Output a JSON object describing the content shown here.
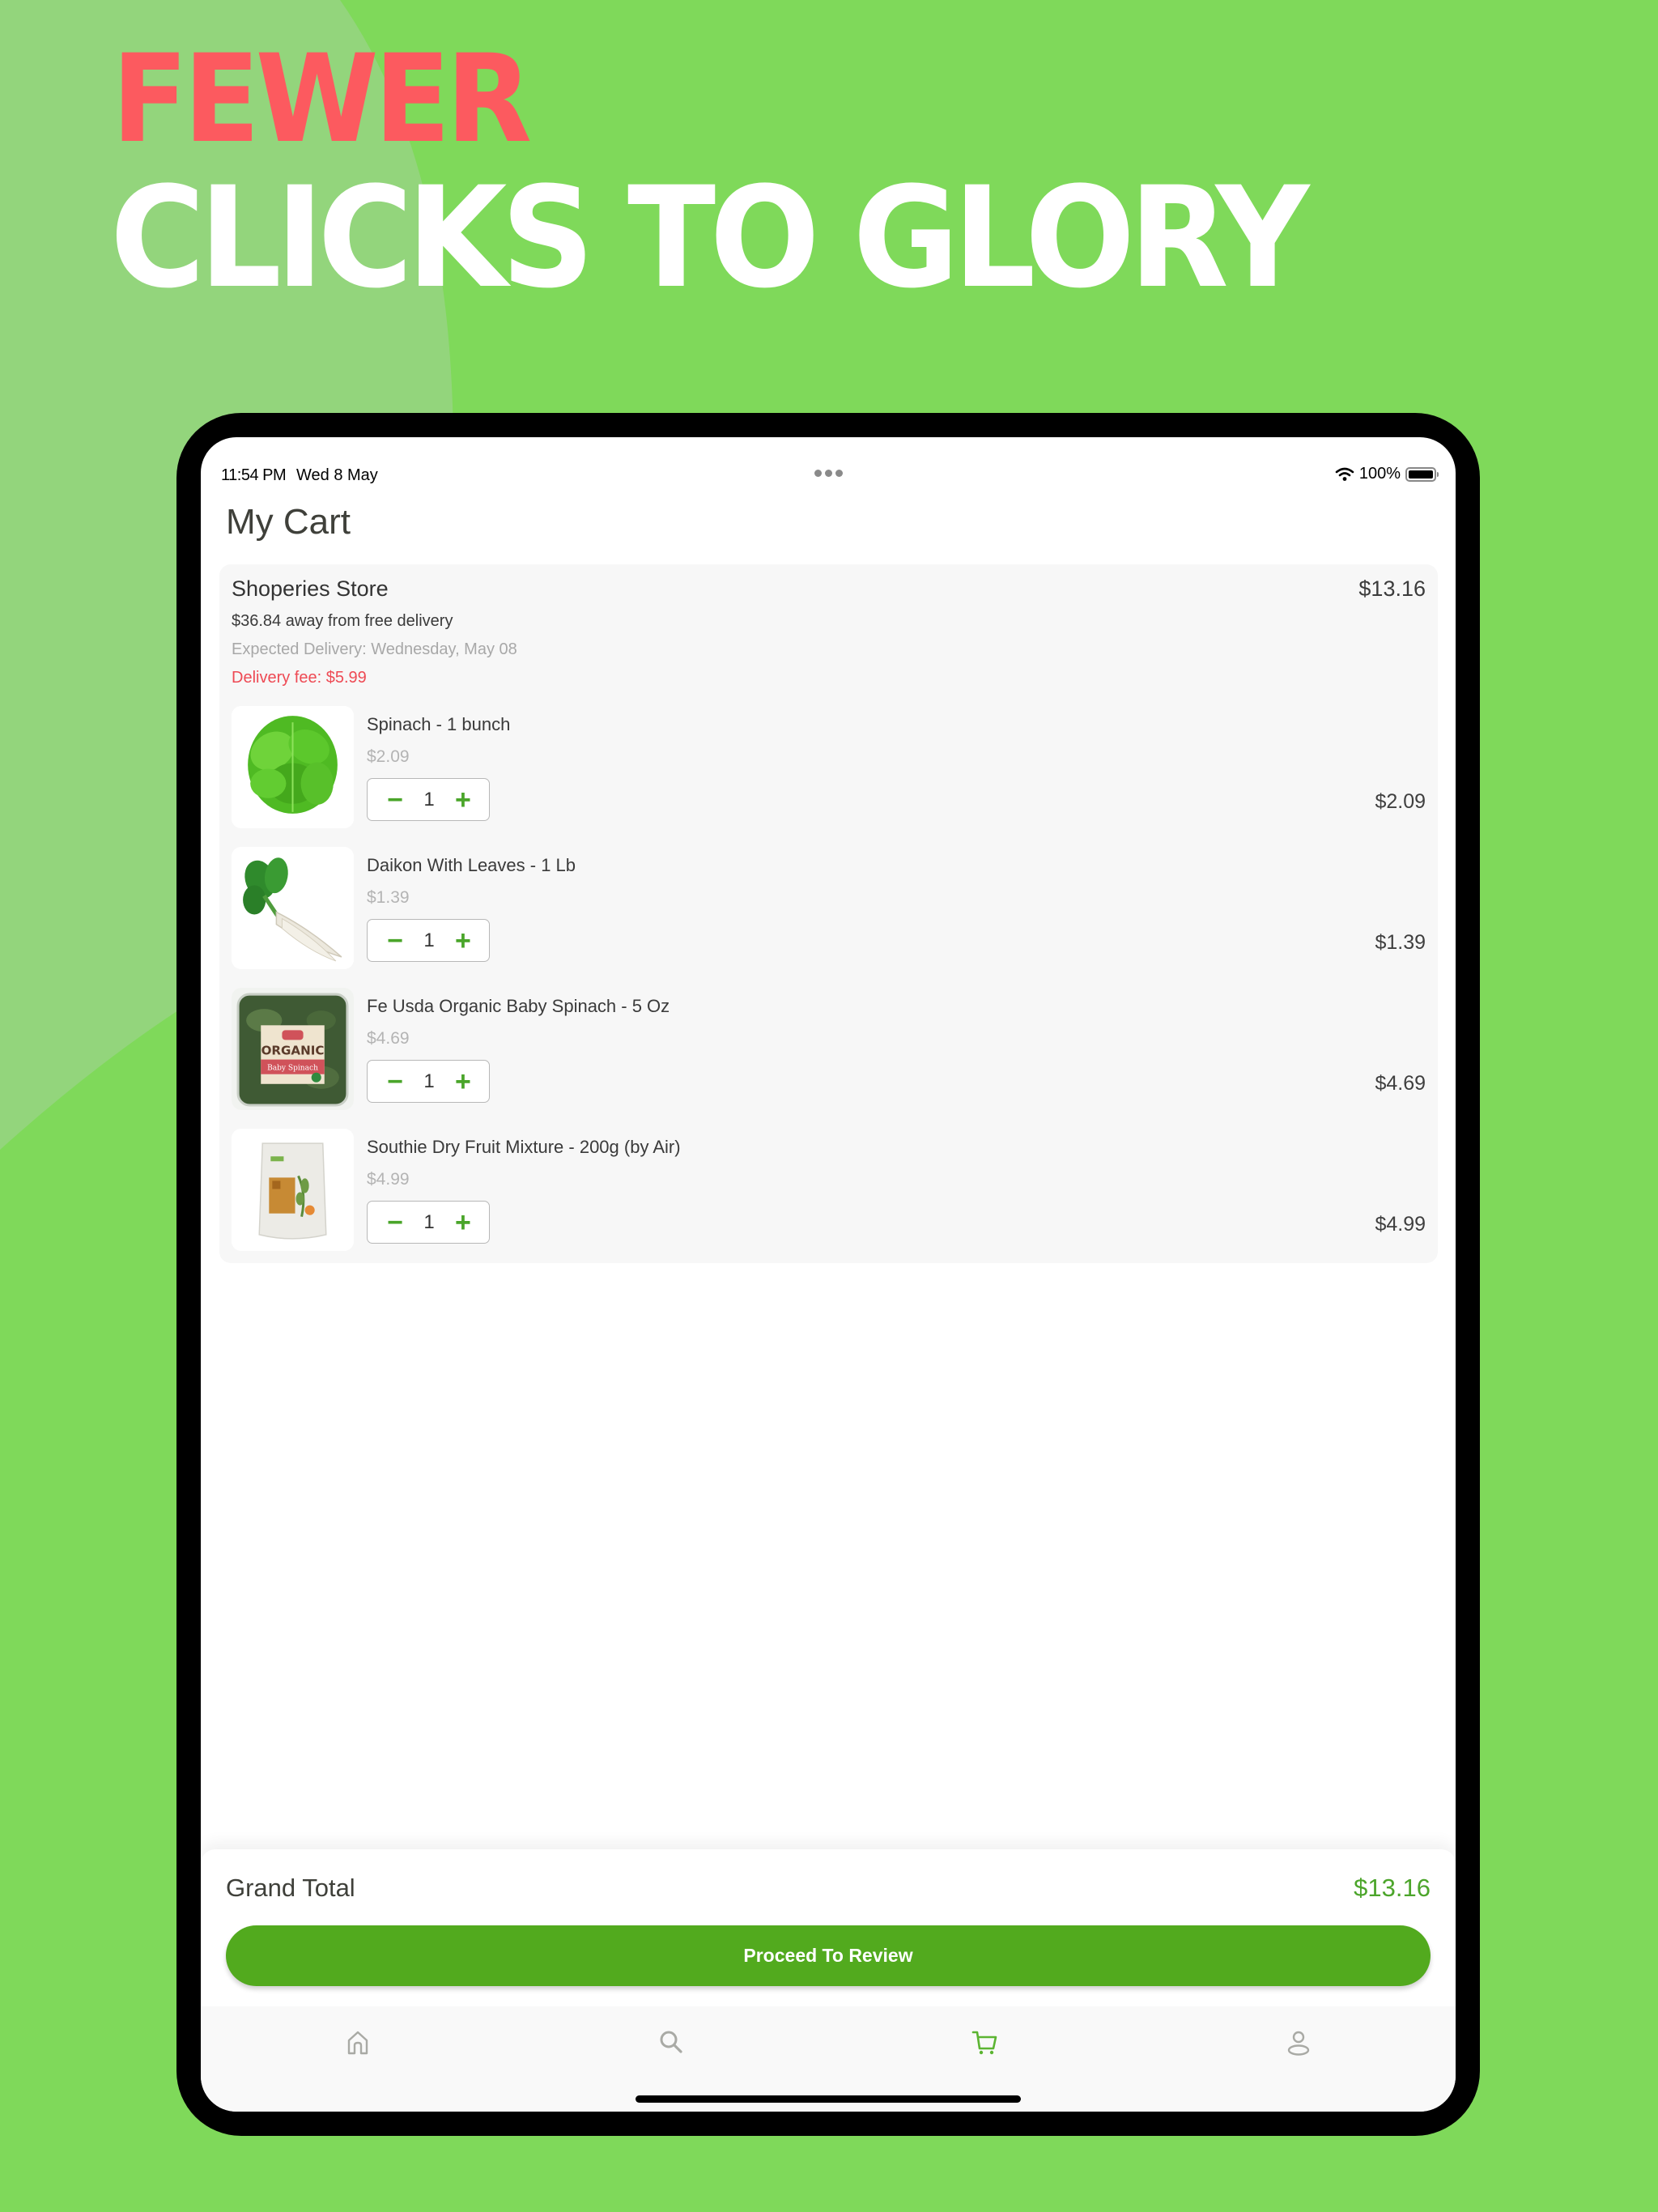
{
  "promo": {
    "headline_line1": "FEWER",
    "headline_line2": "CLICKS TO GLORY",
    "colors": {
      "background": "#7fd95a",
      "headline_accent": "#fc5a5f",
      "headline_main": "#ffffff"
    }
  },
  "status_bar": {
    "time": "11:54 PM",
    "date": "Wed 8 May",
    "battery_text": "100%",
    "battery_level": 1.0,
    "icons": [
      "wifi-icon",
      "battery-icon"
    ]
  },
  "page": {
    "title": "My Cart"
  },
  "store": {
    "name": "Shoperies Store",
    "total": "$13.16",
    "free_delivery_note": "$36.84 away from free delivery",
    "expected_delivery": "Expected Delivery: Wednesday, May 08",
    "delivery_fee": "Delivery fee: $5.99",
    "items": [
      {
        "name": "Spinach - 1 bunch",
        "unit_price": "$2.09",
        "quantity": "1",
        "line_total": "$2.09",
        "image": "spinach-bunch"
      },
      {
        "name": "Daikon With Leaves - 1 Lb",
        "unit_price": "$1.39",
        "quantity": "1",
        "line_total": "$1.39",
        "image": "daikon-with-leaves"
      },
      {
        "name": "Fe Usda Organic Baby Spinach - 5 Oz",
        "unit_price": "$4.69",
        "quantity": "1",
        "line_total": "$4.69",
        "image": "organic-baby-spinach-box",
        "image_label_top": "ORGANIC",
        "image_label_bottom": "Baby Spinach"
      },
      {
        "name": "Southie Dry Fruit Mixture - 200g (by Air)",
        "unit_price": "$4.99",
        "quantity": "1",
        "line_total": "$4.99",
        "image": "dry-fruit-mixture-bag"
      }
    ]
  },
  "stepper": {
    "decrement_symbol": "−",
    "increment_symbol": "+"
  },
  "footer": {
    "grand_total_label": "Grand Total",
    "grand_total_value": "$13.16",
    "proceed_label": "Proceed To Review"
  },
  "tab_bar": {
    "tabs": [
      {
        "id": "home",
        "icon": "home-icon",
        "active": false
      },
      {
        "id": "search",
        "icon": "search-icon",
        "active": false
      },
      {
        "id": "cart",
        "icon": "cart-icon",
        "active": true
      },
      {
        "id": "profile",
        "icon": "profile-icon",
        "active": false
      }
    ],
    "active_color": "#5cb532",
    "inactive_color": "#a9aaa5"
  },
  "colors": {
    "accent_green": "#52aa1e",
    "total_green": "#4ca52b",
    "fee_red": "#ee4a54"
  }
}
